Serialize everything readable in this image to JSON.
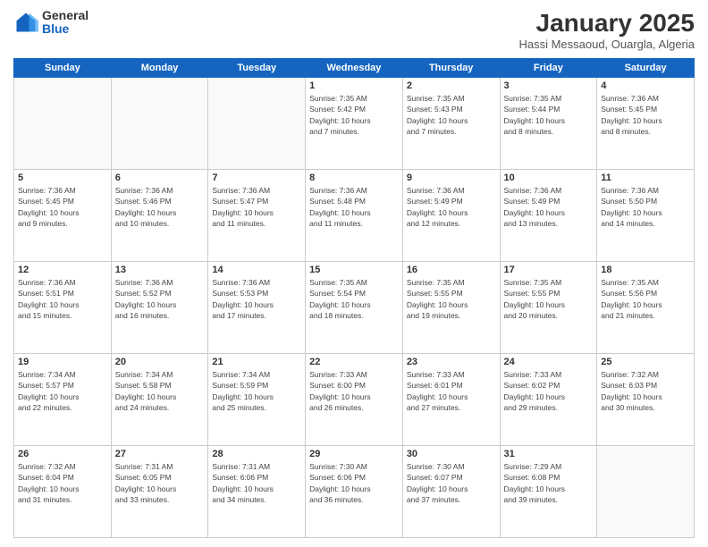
{
  "logo": {
    "general": "General",
    "blue": "Blue"
  },
  "header": {
    "month": "January 2025",
    "location": "Hassi Messaoud, Ouargla, Algeria"
  },
  "weekdays": [
    "Sunday",
    "Monday",
    "Tuesday",
    "Wednesday",
    "Thursday",
    "Friday",
    "Saturday"
  ],
  "weeks": [
    [
      {
        "day": "",
        "info": ""
      },
      {
        "day": "",
        "info": ""
      },
      {
        "day": "",
        "info": ""
      },
      {
        "day": "1",
        "info": "Sunrise: 7:35 AM\nSunset: 5:42 PM\nDaylight: 10 hours\nand 7 minutes."
      },
      {
        "day": "2",
        "info": "Sunrise: 7:35 AM\nSunset: 5:43 PM\nDaylight: 10 hours\nand 7 minutes."
      },
      {
        "day": "3",
        "info": "Sunrise: 7:35 AM\nSunset: 5:44 PM\nDaylight: 10 hours\nand 8 minutes."
      },
      {
        "day": "4",
        "info": "Sunrise: 7:36 AM\nSunset: 5:45 PM\nDaylight: 10 hours\nand 8 minutes."
      }
    ],
    [
      {
        "day": "5",
        "info": "Sunrise: 7:36 AM\nSunset: 5:45 PM\nDaylight: 10 hours\nand 9 minutes."
      },
      {
        "day": "6",
        "info": "Sunrise: 7:36 AM\nSunset: 5:46 PM\nDaylight: 10 hours\nand 10 minutes."
      },
      {
        "day": "7",
        "info": "Sunrise: 7:36 AM\nSunset: 5:47 PM\nDaylight: 10 hours\nand 11 minutes."
      },
      {
        "day": "8",
        "info": "Sunrise: 7:36 AM\nSunset: 5:48 PM\nDaylight: 10 hours\nand 11 minutes."
      },
      {
        "day": "9",
        "info": "Sunrise: 7:36 AM\nSunset: 5:49 PM\nDaylight: 10 hours\nand 12 minutes."
      },
      {
        "day": "10",
        "info": "Sunrise: 7:36 AM\nSunset: 5:49 PM\nDaylight: 10 hours\nand 13 minutes."
      },
      {
        "day": "11",
        "info": "Sunrise: 7:36 AM\nSunset: 5:50 PM\nDaylight: 10 hours\nand 14 minutes."
      }
    ],
    [
      {
        "day": "12",
        "info": "Sunrise: 7:36 AM\nSunset: 5:51 PM\nDaylight: 10 hours\nand 15 minutes."
      },
      {
        "day": "13",
        "info": "Sunrise: 7:36 AM\nSunset: 5:52 PM\nDaylight: 10 hours\nand 16 minutes."
      },
      {
        "day": "14",
        "info": "Sunrise: 7:36 AM\nSunset: 5:53 PM\nDaylight: 10 hours\nand 17 minutes."
      },
      {
        "day": "15",
        "info": "Sunrise: 7:35 AM\nSunset: 5:54 PM\nDaylight: 10 hours\nand 18 minutes."
      },
      {
        "day": "16",
        "info": "Sunrise: 7:35 AM\nSunset: 5:55 PM\nDaylight: 10 hours\nand 19 minutes."
      },
      {
        "day": "17",
        "info": "Sunrise: 7:35 AM\nSunset: 5:55 PM\nDaylight: 10 hours\nand 20 minutes."
      },
      {
        "day": "18",
        "info": "Sunrise: 7:35 AM\nSunset: 5:56 PM\nDaylight: 10 hours\nand 21 minutes."
      }
    ],
    [
      {
        "day": "19",
        "info": "Sunrise: 7:34 AM\nSunset: 5:57 PM\nDaylight: 10 hours\nand 22 minutes."
      },
      {
        "day": "20",
        "info": "Sunrise: 7:34 AM\nSunset: 5:58 PM\nDaylight: 10 hours\nand 24 minutes."
      },
      {
        "day": "21",
        "info": "Sunrise: 7:34 AM\nSunset: 5:59 PM\nDaylight: 10 hours\nand 25 minutes."
      },
      {
        "day": "22",
        "info": "Sunrise: 7:33 AM\nSunset: 6:00 PM\nDaylight: 10 hours\nand 26 minutes."
      },
      {
        "day": "23",
        "info": "Sunrise: 7:33 AM\nSunset: 6:01 PM\nDaylight: 10 hours\nand 27 minutes."
      },
      {
        "day": "24",
        "info": "Sunrise: 7:33 AM\nSunset: 6:02 PM\nDaylight: 10 hours\nand 29 minutes."
      },
      {
        "day": "25",
        "info": "Sunrise: 7:32 AM\nSunset: 6:03 PM\nDaylight: 10 hours\nand 30 minutes."
      }
    ],
    [
      {
        "day": "26",
        "info": "Sunrise: 7:32 AM\nSunset: 6:04 PM\nDaylight: 10 hours\nand 31 minutes."
      },
      {
        "day": "27",
        "info": "Sunrise: 7:31 AM\nSunset: 6:05 PM\nDaylight: 10 hours\nand 33 minutes."
      },
      {
        "day": "28",
        "info": "Sunrise: 7:31 AM\nSunset: 6:06 PM\nDaylight: 10 hours\nand 34 minutes."
      },
      {
        "day": "29",
        "info": "Sunrise: 7:30 AM\nSunset: 6:06 PM\nDaylight: 10 hours\nand 36 minutes."
      },
      {
        "day": "30",
        "info": "Sunrise: 7:30 AM\nSunset: 6:07 PM\nDaylight: 10 hours\nand 37 minutes."
      },
      {
        "day": "31",
        "info": "Sunrise: 7:29 AM\nSunset: 6:08 PM\nDaylight: 10 hours\nand 39 minutes."
      },
      {
        "day": "",
        "info": ""
      }
    ]
  ]
}
